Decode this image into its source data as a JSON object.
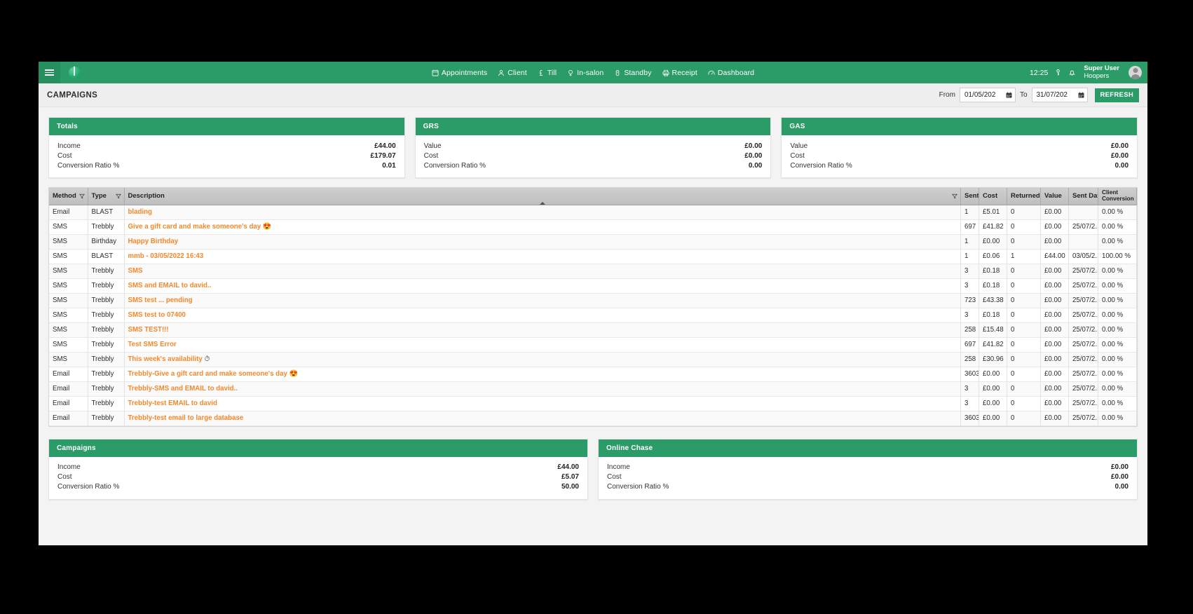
{
  "topbar": {
    "menu_icon": "hamburger-icon",
    "logo": "app-logo",
    "nav": [
      {
        "label": "Appointments",
        "icon": "calendar-icon"
      },
      {
        "label": "Client",
        "icon": "person-icon"
      },
      {
        "label": "Till",
        "icon": "pound-icon"
      },
      {
        "label": "In-salon",
        "icon": "location-pin-icon"
      },
      {
        "label": "Standby",
        "icon": "standby-icon"
      },
      {
        "label": "Receipt",
        "icon": "printer-icon"
      },
      {
        "label": "Dashboard",
        "icon": "gauge-icon"
      }
    ],
    "clock": "12:25",
    "key_icon": "key-icon",
    "bell_icon": "bell-icon",
    "user_name": "Super User",
    "user_salon": "Hoopers",
    "avatar": "user-avatar"
  },
  "pagehead": {
    "title": "CAMPAIGNS",
    "from_label": "From",
    "from_value": "01/05/202",
    "to_label": "To",
    "to_value": "31/07/202",
    "refresh_label": "REFRESH",
    "calendar_icon": "calendar-icon"
  },
  "summary_cards": [
    {
      "title": "Totals",
      "rows": [
        {
          "label": "Income",
          "value": "£44.00"
        },
        {
          "label": "Cost",
          "value": "£179.07"
        },
        {
          "label": "Conversion Ratio %",
          "value": "0.01"
        }
      ]
    },
    {
      "title": "GRS",
      "rows": [
        {
          "label": "Value",
          "value": "£0.00"
        },
        {
          "label": "Cost",
          "value": "£0.00"
        },
        {
          "label": "Conversion Ratio %",
          "value": "0.00"
        }
      ]
    },
    {
      "title": "GAS",
      "rows": [
        {
          "label": "Value",
          "value": "£0.00"
        },
        {
          "label": "Cost",
          "value": "£0.00"
        },
        {
          "label": "Conversion Ratio %",
          "value": "0.00"
        }
      ]
    }
  ],
  "table": {
    "columns": [
      {
        "key": "method",
        "label": "Method",
        "filter": true
      },
      {
        "key": "type",
        "label": "Type",
        "filter": true
      },
      {
        "key": "description",
        "label": "Description",
        "filter": true,
        "sorted": true
      },
      {
        "key": "sent",
        "label": "Sent",
        "filter": false
      },
      {
        "key": "cost",
        "label": "Cost",
        "filter": false
      },
      {
        "key": "returned",
        "label": "Returned",
        "filter": false
      },
      {
        "key": "value",
        "label": "Value",
        "filter": false
      },
      {
        "key": "sent_date",
        "label": "Sent Date",
        "filter": false
      },
      {
        "key": "client_conversion",
        "label": "Client Conversion",
        "filter": false
      }
    ],
    "rows": [
      {
        "method": "Email",
        "type": "BLAST",
        "description": "blading",
        "emoji": "",
        "sent": "1",
        "cost": "£5.01",
        "returned": "0",
        "value": "£0.00",
        "sent_date": "",
        "client_conversion": "0.00 %"
      },
      {
        "method": "SMS",
        "type": "Trebbly",
        "description": "Give a gift card and make someone's day",
        "emoji": "😍",
        "sent": "697",
        "cost": "£41.82",
        "returned": "0",
        "value": "£0.00",
        "sent_date": "25/07/2...",
        "client_conversion": "0.00 %"
      },
      {
        "method": "SMS",
        "type": "Birthday",
        "description": "Happy Birthday",
        "emoji": "",
        "sent": "1",
        "cost": "£0.00",
        "returned": "0",
        "value": "£0.00",
        "sent_date": "",
        "client_conversion": "0.00 %"
      },
      {
        "method": "SMS",
        "type": "BLAST",
        "description": "mmb - 03/05/2022 16:43",
        "emoji": "",
        "sent": "1",
        "cost": "£0.06",
        "returned": "1",
        "value": "£44.00",
        "sent_date": "03/05/2...",
        "client_conversion": "100.00 %"
      },
      {
        "method": "SMS",
        "type": "Trebbly",
        "description": "SMS",
        "emoji": "",
        "sent": "3",
        "cost": "£0.18",
        "returned": "0",
        "value": "£0.00",
        "sent_date": "25/07/2...",
        "client_conversion": "0.00 %"
      },
      {
        "method": "SMS",
        "type": "Trebbly",
        "description": "SMS and EMAIL to david..",
        "emoji": "",
        "sent": "3",
        "cost": "£0.18",
        "returned": "0",
        "value": "£0.00",
        "sent_date": "25/07/2...",
        "client_conversion": "0.00 %"
      },
      {
        "method": "SMS",
        "type": "Trebbly",
        "description": "SMS test ... pending",
        "emoji": "",
        "sent": "723",
        "cost": "£43.38",
        "returned": "0",
        "value": "£0.00",
        "sent_date": "25/07/2...",
        "client_conversion": "0.00 %"
      },
      {
        "method": "SMS",
        "type": "Trebbly",
        "description": "SMS test to 07400",
        "emoji": "",
        "sent": "3",
        "cost": "£0.18",
        "returned": "0",
        "value": "£0.00",
        "sent_date": "25/07/2...",
        "client_conversion": "0.00 %"
      },
      {
        "method": "SMS",
        "type": "Trebbly",
        "description": "SMS TEST!!!",
        "emoji": "",
        "sent": "258",
        "cost": "£15.48",
        "returned": "0",
        "value": "£0.00",
        "sent_date": "25/07/2...",
        "client_conversion": "0.00 %"
      },
      {
        "method": "SMS",
        "type": "Trebbly",
        "description": "Test SMS Error",
        "emoji": "",
        "sent": "697",
        "cost": "£41.82",
        "returned": "0",
        "value": "£0.00",
        "sent_date": "25/07/2...",
        "client_conversion": "0.00 %"
      },
      {
        "method": "SMS",
        "type": "Trebbly",
        "description": "This week's availability",
        "emoji": "⏱",
        "sent": "258",
        "cost": "£30.96",
        "returned": "0",
        "value": "£0.00",
        "sent_date": "25/07/2...",
        "client_conversion": "0.00 %"
      },
      {
        "method": "Email",
        "type": "Trebbly",
        "description": "Trebbly-Give a gift card and make someone's day",
        "emoji": "😍",
        "sent": "3603",
        "cost": "£0.00",
        "returned": "0",
        "value": "£0.00",
        "sent_date": "25/07/2...",
        "client_conversion": "0.00 %"
      },
      {
        "method": "Email",
        "type": "Trebbly",
        "description": "Trebbly-SMS and EMAIL to david..",
        "emoji": "",
        "sent": "3",
        "cost": "£0.00",
        "returned": "0",
        "value": "£0.00",
        "sent_date": "25/07/2...",
        "client_conversion": "0.00 %"
      },
      {
        "method": "Email",
        "type": "Trebbly",
        "description": "Trebbly-test EMAIL to david",
        "emoji": "",
        "sent": "3",
        "cost": "£0.00",
        "returned": "0",
        "value": "£0.00",
        "sent_date": "25/07/2...",
        "client_conversion": "0.00 %"
      },
      {
        "method": "Email",
        "type": "Trebbly",
        "description": "Trebbly-test email to large database",
        "emoji": "",
        "sent": "3603",
        "cost": "£0.00",
        "returned": "0",
        "value": "£0.00",
        "sent_date": "25/07/2...",
        "client_conversion": "0.00 %"
      }
    ]
  },
  "bottom_cards": [
    {
      "title": "Campaigns",
      "rows": [
        {
          "label": "Income",
          "value": "£44.00"
        },
        {
          "label": "Cost",
          "value": "£5.07"
        },
        {
          "label": "Conversion Ratio %",
          "value": "50.00"
        }
      ]
    },
    {
      "title": "Online Chase",
      "rows": [
        {
          "label": "Income",
          "value": "£0.00"
        },
        {
          "label": "Cost",
          "value": "£0.00"
        },
        {
          "label": "Conversion Ratio %",
          "value": "0.00"
        }
      ]
    }
  ],
  "colors": {
    "brand_green": "#2b9c68",
    "link_orange": "#f5872a",
    "header_gray": "#c9c9c9"
  }
}
